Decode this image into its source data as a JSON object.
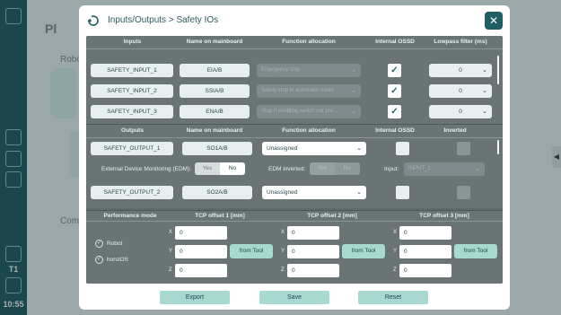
{
  "background": {
    "clock": "10:55",
    "mode": "T1",
    "ghost_title": "Pl",
    "ghost_robot": "Robot",
    "ghost_comp": "Comp",
    "ghost_small": "tcp"
  },
  "header": {
    "crumb_parent": "Inputs/Outputs",
    "crumb_sep": ">",
    "crumb_current": "Safety IOs",
    "close": "✕"
  },
  "inputs": {
    "headers": [
      "Inputs",
      "Name on mainboard",
      "Function allocation",
      "Internal OSSD",
      "Lowpass filter (ms)"
    ],
    "rows": [
      {
        "name": "SAFETY_INPUT_1",
        "board": "EIA/B",
        "function": "Emergency stop",
        "lowpass": "0"
      },
      {
        "name": "SAFETY_INPUT_2",
        "board": "SSIA/B",
        "function": "Safety stop in automatic mode",
        "lowpass": "0"
      },
      {
        "name": "SAFETY_INPUT_3",
        "board": "ENA/B",
        "function": "Stop if enabling switch not pre...",
        "lowpass": "0"
      }
    ]
  },
  "outputs": {
    "headers": [
      "Outputs",
      "Name on mainboard",
      "Function allocation",
      "Internal OSSD",
      "Inverted"
    ],
    "rows": [
      {
        "name": "SAFETY_OUTPUT_1",
        "board": "SO1A/B",
        "function": "Unassigned"
      },
      {
        "name": "SAFETY_OUTPUT_2",
        "board": "SO2A/B",
        "function": "Unassigned"
      }
    ],
    "edm_label": "External Device Monitoring (EDM):",
    "edm_yes": "Yes",
    "edm_no": "No",
    "edm_inverted_label": "EDM inverted:",
    "edm_inv_yes": "Yes",
    "edm_inv_no": "No",
    "input_label": "Input:",
    "input_value": "INPUT_1"
  },
  "tcp": {
    "headers": [
      "Performance mode",
      "TCP offset 1 [mm]",
      "TCP offset 2 [mm]",
      "TCP offset 3 [mm]"
    ],
    "modes": [
      "Robot",
      "horstOS"
    ],
    "axes": [
      "X",
      "Y",
      "Z"
    ],
    "values": [
      "0",
      "0",
      "0"
    ],
    "from_tool": "from Tool"
  },
  "footer": {
    "export": "Export",
    "save": "Save",
    "reset": "Reset"
  },
  "colors": {
    "accent": "#1f5f64",
    "button": "#a7d9d1",
    "panel": "#6b7475"
  }
}
